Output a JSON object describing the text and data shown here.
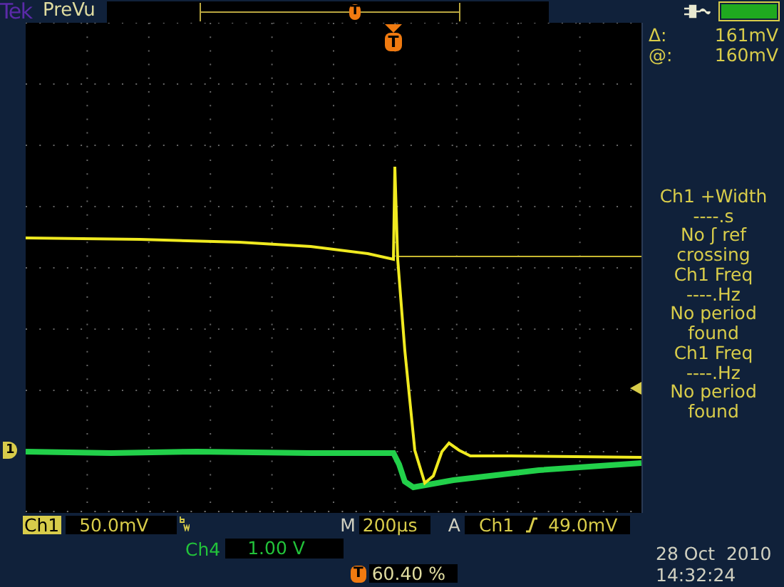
{
  "top_bar": {
    "brand": "Tek",
    "mode": "PreVu",
    "trigger_marker": "T"
  },
  "graticule": {
    "trigger_marker": "T",
    "channel_marker": "1"
  },
  "cursor_readouts": [
    {
      "label": "Δ:",
      "value": "161mV"
    },
    {
      "label": "@:",
      "value": "160mV"
    }
  ],
  "measurements": [
    {
      "lines": [
        "Ch1 +Width",
        "----.s",
        "No ʃ ref",
        "crossing"
      ]
    },
    {
      "lines": [
        "Ch1 Freq",
        "----.Hz",
        "No period",
        "found"
      ]
    },
    {
      "lines": [
        "Ch1 Freq",
        "----.Hz",
        "No period",
        "found"
      ]
    }
  ],
  "channels": [
    {
      "label": "Ch1",
      "scale": "50.0mV",
      "bandwidth_limited": true
    },
    {
      "label": "Ch4",
      "scale": "1.00 V"
    }
  ],
  "timebase": {
    "label": "M",
    "value": "200µs"
  },
  "trigger": {
    "label": "A",
    "source": "Ch1",
    "level": "49.0mV"
  },
  "trigger_position": {
    "marker": "T",
    "value": "60.40 %"
  },
  "date": "28 Oct  2010",
  "time": "14:32:24"
}
